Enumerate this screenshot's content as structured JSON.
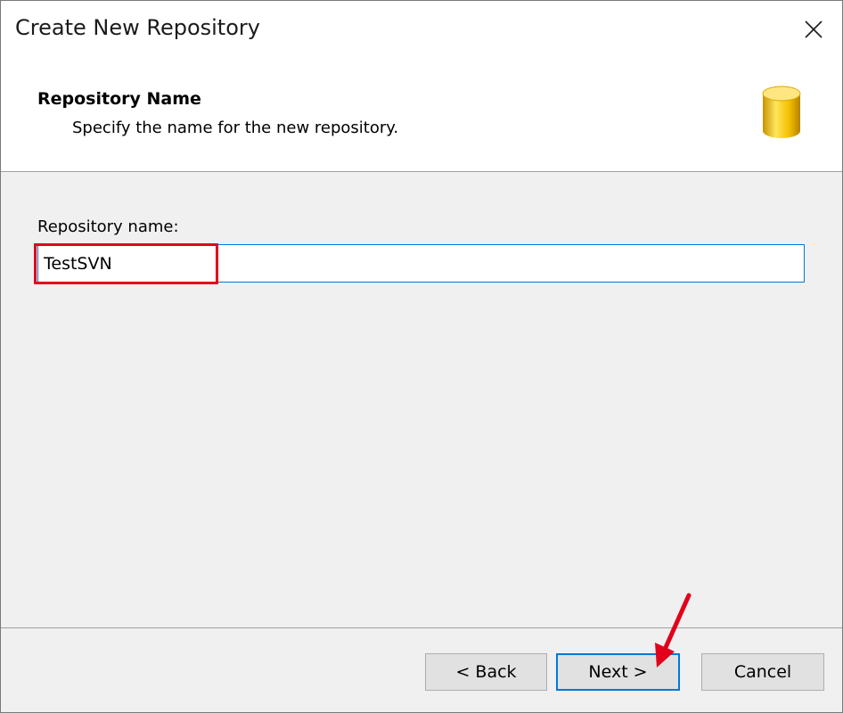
{
  "window": {
    "title": "Create New Repository",
    "close_icon": "close-icon"
  },
  "header": {
    "title": "Repository Name",
    "subtitle": "Specify the name for the new repository.",
    "icon": "database-icon"
  },
  "form": {
    "label": "Repository name:",
    "value": "TestSVN"
  },
  "buttons": {
    "back": "< Back",
    "next": "Next >",
    "cancel": "Cancel"
  },
  "annotation_colors": {
    "highlight": "#e3001b",
    "accent": "#0078d7"
  }
}
